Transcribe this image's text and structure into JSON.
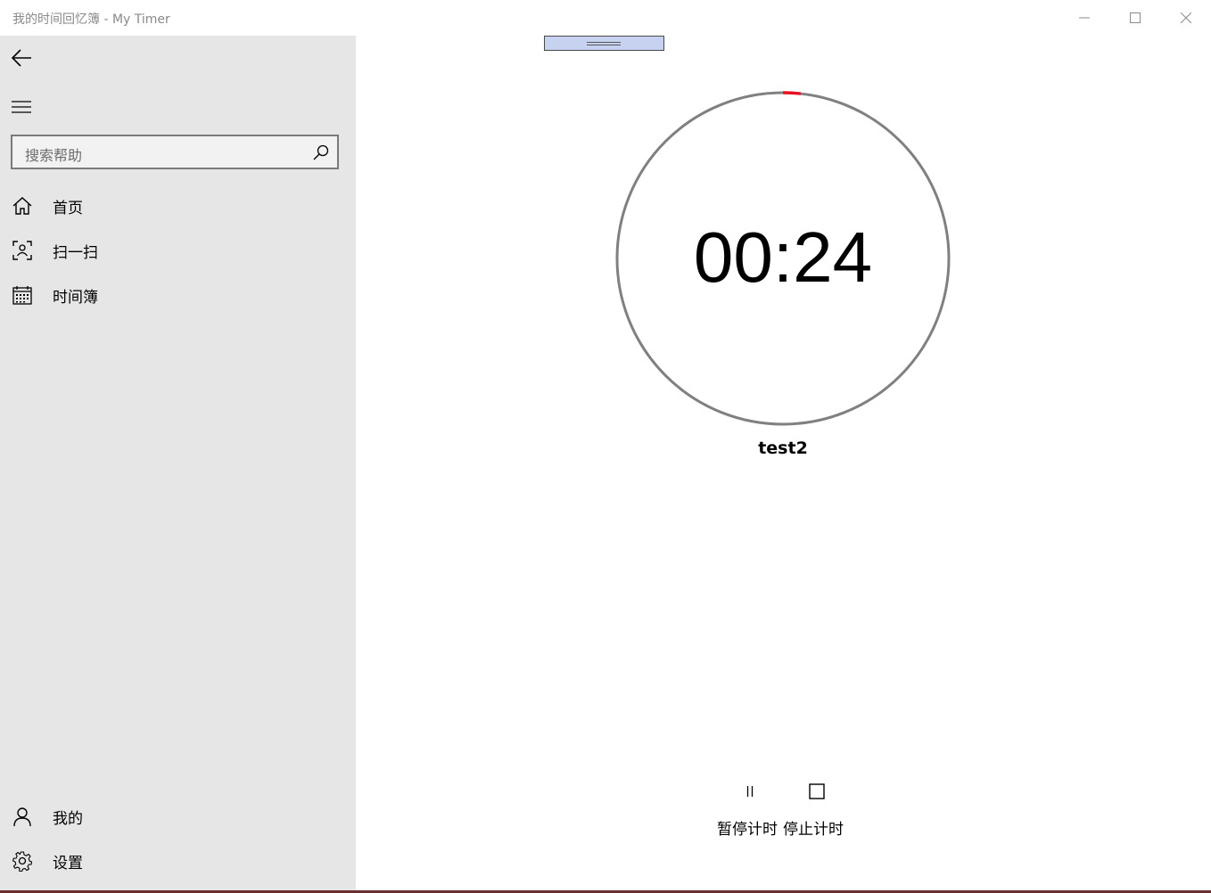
{
  "window": {
    "title": "我的时间回忆簿 - My Timer",
    "minimize_icon": "minimize-icon",
    "maximize_icon": "maximize-icon",
    "close_icon": "close-icon"
  },
  "sidebar": {
    "back_icon": "back-arrow-icon",
    "menu_icon": "hamburger-menu-icon",
    "search": {
      "placeholder": "搜索帮助",
      "icon": "search-icon"
    },
    "items": [
      {
        "label": "首页",
        "icon": "home-icon"
      },
      {
        "label": "扫一扫",
        "icon": "scan-icon"
      },
      {
        "label": "时间簿",
        "icon": "calendar-icon"
      }
    ],
    "footer_items": [
      {
        "label": "我的",
        "icon": "person-icon"
      },
      {
        "label": "设置",
        "icon": "gear-icon"
      }
    ]
  },
  "timer": {
    "display": "00:24",
    "task_name": "test2",
    "ring_color": "#808080",
    "progress_color": "#e81123",
    "progress_fraction": 0.017
  },
  "controls": {
    "pause_label": "暂停计时",
    "stop_label": "停止计时",
    "pause_icon": "pause-icon",
    "stop_icon": "stop-icon"
  }
}
